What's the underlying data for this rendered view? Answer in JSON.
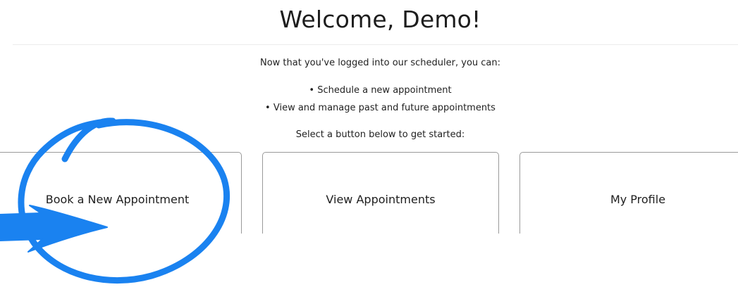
{
  "header": {
    "title": "Welcome, Demo!"
  },
  "intro": {
    "text": "Now that you've logged into our scheduler, you can:",
    "bullets": [
      "• Schedule a new appointment",
      "• View and manage past and future appointments"
    ],
    "prompt": "Select a button below to get started:"
  },
  "actions": [
    {
      "label": "Book a New Appointment"
    },
    {
      "label": "View Appointments"
    },
    {
      "label": "My Profile"
    }
  ],
  "annotation": {
    "color": "#1a82f0",
    "shapes": [
      "circle-highlight",
      "arrow-pointer"
    ]
  }
}
